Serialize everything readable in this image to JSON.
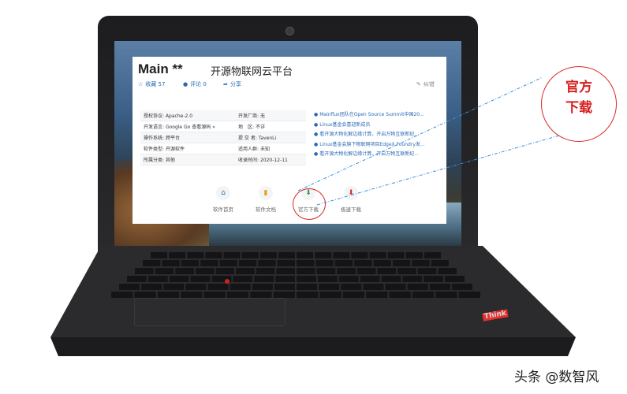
{
  "page": {
    "title_main": "Main **",
    "title_sub": "开源物联网云平台",
    "meta": {
      "collect_label": "收藏",
      "collect_count": "57",
      "comment_label": "评论",
      "comment_count": "0",
      "share_label": "分享",
      "edit_label": "纠错"
    },
    "info_rows": [
      {
        "k1": "授权协议:",
        "v1": "Apache-2.0",
        "k2": "开发厂商:",
        "v2": "无"
      },
      {
        "k1": "开发语言:",
        "v1": "Google Go 查看源码 »",
        "k2": "地　区:",
        "v2": "不详"
      },
      {
        "k1": "操作系统:",
        "v1": "跨平台",
        "k2": "提 交 者:",
        "v2": "TavenLi"
      },
      {
        "k1": "软件类型:",
        "v1": "开源软件",
        "k2": "适用人群:",
        "v2": "未知"
      },
      {
        "k1": "所属分类:",
        "v1": "其他",
        "k2": "收录时间:",
        "v2": "2020-12-11"
      }
    ],
    "news": [
      "Mainflux团队在Open Source Summit中国20...",
      "Linux基金会喜迎新成员",
      "看开源大物化解边缘计算，开启万物互联新纪...",
      "Linux基金会旗下物联网项目EdgeX Foundry发...",
      "看开源大物化解边缘计算，开启万物互联新纪..."
    ],
    "buttons": {
      "home": "软件首页",
      "docs": "软件文档",
      "official": "官方下载",
      "fast": "极速下载"
    }
  },
  "callout": {
    "line1": "官方",
    "line2": "下载"
  },
  "watermark": "头条 @数智风",
  "colors": {
    "accent_red": "#d62a2a",
    "link_blue": "#2a6ab5"
  },
  "icons": {
    "collect": "star-icon",
    "comment": "comment-icon",
    "share": "share-icon",
    "edit": "pencil-icon",
    "home": "home-icon",
    "docs": "document-icon",
    "official": "download-icon",
    "fast": "fast-download-icon"
  }
}
